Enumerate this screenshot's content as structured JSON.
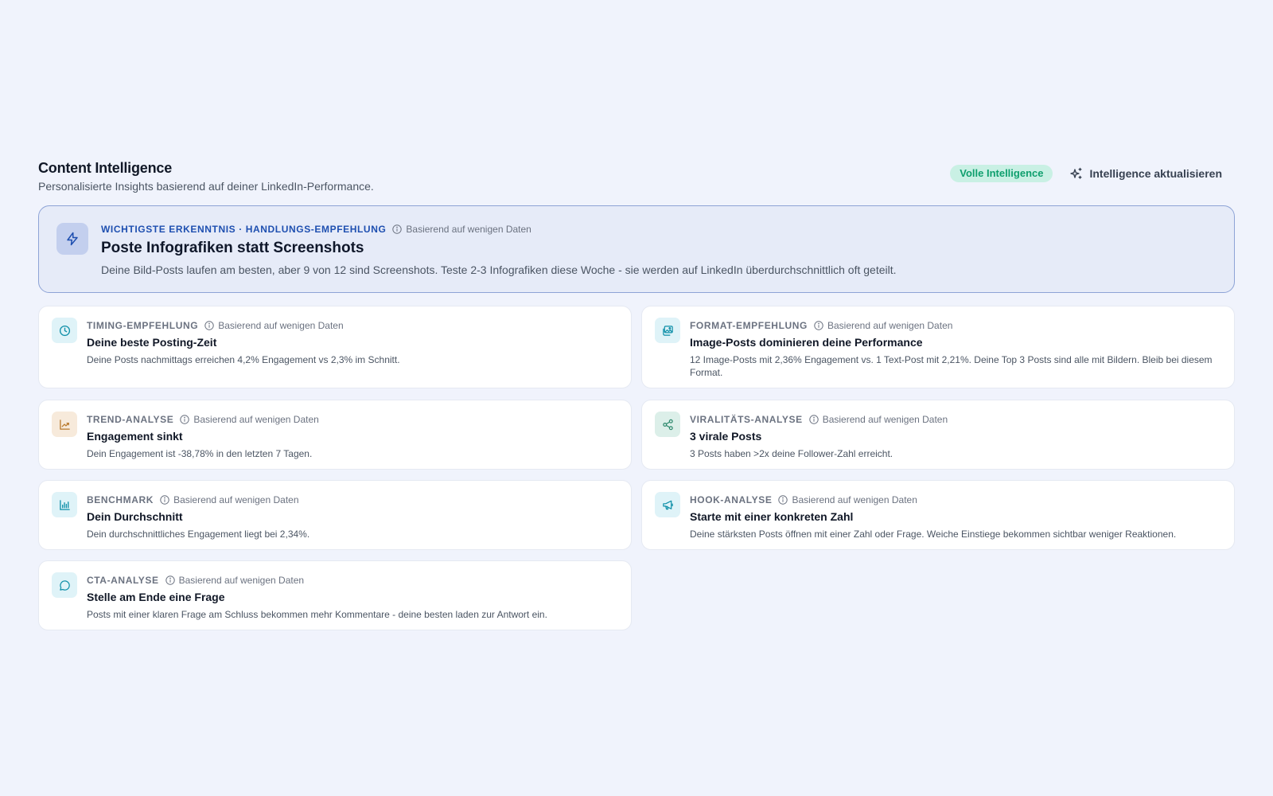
{
  "header": {
    "title": "Content Intelligence",
    "subtitle": "Personalisierte Insights basierend auf deiner LinkedIn-Performance.",
    "badge": "Volle Intelligence",
    "refresh_label": "Intelligence aktualisieren"
  },
  "hero": {
    "eyebrow": "WICHTIGSTE ERKENNTNIS · HANDLUNGS-EMPFEHLUNG",
    "meta": "Basierend auf wenigen Daten",
    "title": "Poste Infografiken statt Screenshots",
    "text": "Deine Bild-Posts laufen am besten, aber 9 von 12 sind Screenshots. Teste 2-3 Infografiken diese Woche - sie werden auf LinkedIn überdurchschnittlich oft geteilt.",
    "icon": "lightning-icon"
  },
  "cards": [
    {
      "eyebrow": "TIMING-EMPFEHLUNG",
      "meta": "Basierend auf wenigen Daten",
      "title": "Deine beste Posting-Zeit",
      "text": "Deine Posts nachmittags erreichen 4,2% Engagement vs 2,3% im Schnitt.",
      "icon": "clock-icon"
    },
    {
      "eyebrow": "FORMAT-EMPFEHLUNG",
      "meta": "Basierend auf wenigen Daten",
      "title": "Image-Posts dominieren deine Performance",
      "text": "12 Image-Posts mit 2,36% Engagement vs. 1 Text-Post mit 2,21%. Deine Top 3 Posts sind alle mit Bildern. Bleib bei diesem Format.",
      "icon": "images-icon"
    },
    {
      "eyebrow": "TREND-ANALYSE",
      "meta": "Basierend auf wenigen Daten",
      "title": "Engagement sinkt",
      "text": "Dein Engagement ist -38,78% in den letzten 7 Tagen.",
      "icon": "trend-chart-icon"
    },
    {
      "eyebrow": "VIRALITÄTS-ANALYSE",
      "meta": "Basierend auf wenigen Daten",
      "title": "3 virale Posts",
      "text": "3 Posts haben >2x deine Follower-Zahl erreicht.",
      "icon": "share-icon"
    },
    {
      "eyebrow": "BENCHMARK",
      "meta": "Basierend auf wenigen Daten",
      "title": "Dein Durchschnitt",
      "text": "Dein durchschnittliches Engagement liegt bei 2,34%.",
      "icon": "bar-chart-icon"
    },
    {
      "eyebrow": "HOOK-ANALYSE",
      "meta": "Basierend auf wenigen Daten",
      "title": "Starte mit einer konkreten Zahl",
      "text": "Deine stärksten Posts öffnen mit einer Zahl oder Frage. Weiche Einstiege bekommen sichtbar weniger Reaktionen.",
      "icon": "megaphone-icon"
    },
    {
      "eyebrow": "CTA-ANALYSE",
      "meta": "Basierend auf wenigen Daten",
      "title": "Stelle am Ende eine Frage",
      "text": "Posts mit einer klaren Frage am Schluss bekommen mehr Kommentare - deine besten laden zur Antwort ein.",
      "icon": "message-circle-icon"
    }
  ],
  "colors": {
    "background": "#f0f3fc",
    "accent_blue": "#1e4fb0",
    "badge_green": "#0f9f6e",
    "teal_icon": "#0e8fa8",
    "orange_icon": "#b97a2e",
    "green_icon": "#2f8a6e"
  }
}
